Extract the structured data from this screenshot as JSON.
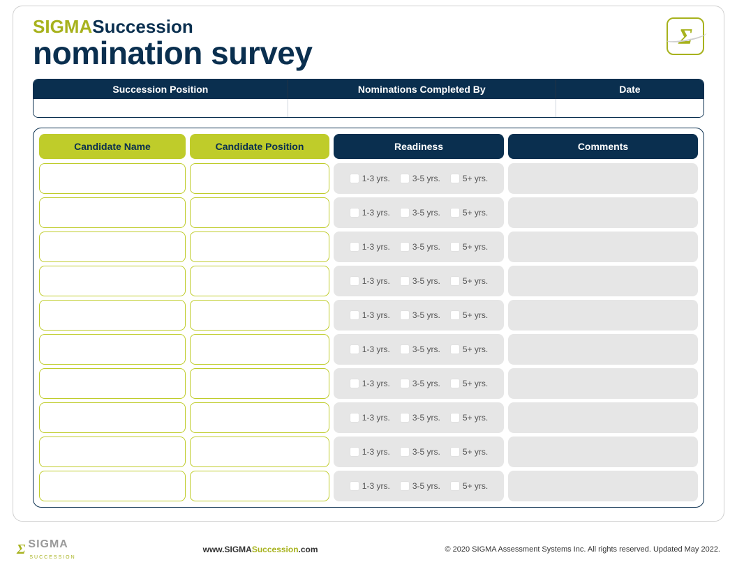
{
  "brand": {
    "sigma": "SIGMA",
    "succession": "Succession"
  },
  "title": "nomination survey",
  "top_headers": {
    "c1": "Succession Position",
    "c2": "Nominations Completed By",
    "c3": "Date"
  },
  "grid_headers": {
    "name": "Candidate Name",
    "position": "Candidate Position",
    "readiness": "Readiness",
    "comments": "Comments"
  },
  "readiness_options": {
    "a": "1-3 yrs.",
    "b": "3-5 yrs.",
    "c": "5+ yrs."
  },
  "row_count": 10,
  "footer": {
    "logo_text": "SIGMA",
    "logo_sub": "SUCCESSION",
    "url_prefix": "www.",
    "url_main": "SIGMA",
    "url_accent": "Succession",
    "url_suffix": ".com",
    "copyright": "© 2020 SIGMA Assessment Systems Inc. All rights reserved. Updated May 2022."
  }
}
